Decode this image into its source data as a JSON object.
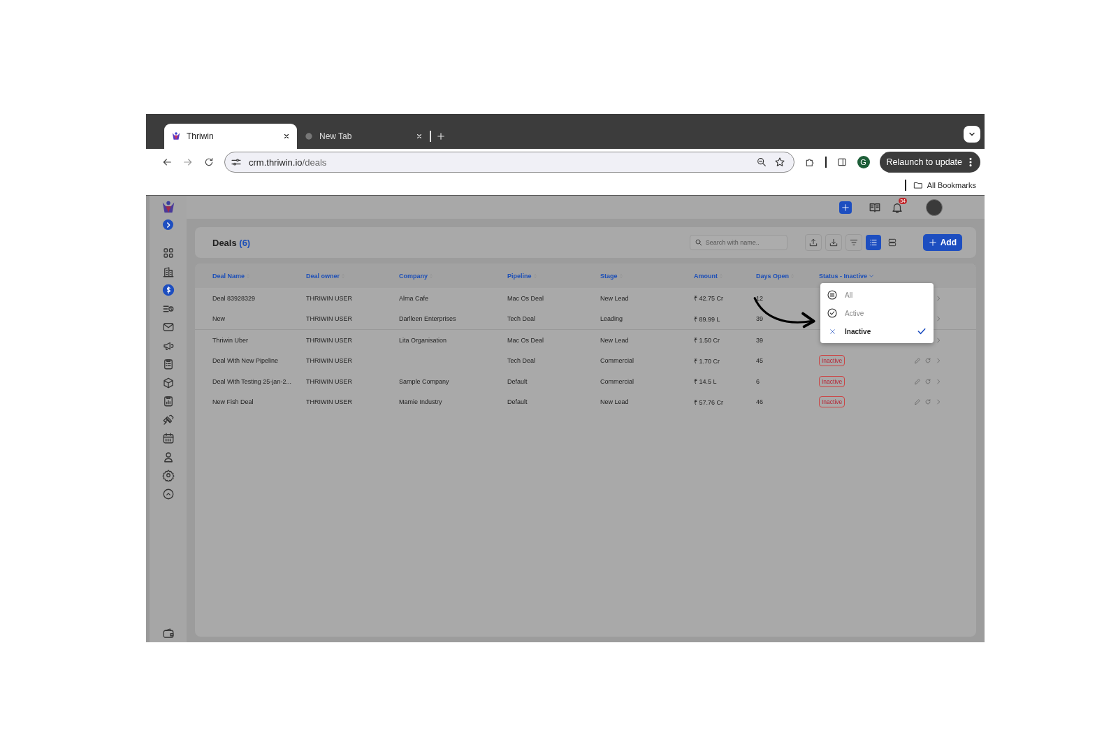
{
  "browser": {
    "tabs": [
      {
        "title": "Thriwin",
        "selected": true,
        "kind": "app"
      },
      {
        "title": "New Tab",
        "selected": false,
        "kind": "globe"
      }
    ],
    "url": {
      "host": "crm.thriwin.io",
      "path": "/deals"
    },
    "profile_initial": "G",
    "relaunch": "Relaunch to update",
    "bookmarks": "All Bookmarks"
  },
  "sidebar": {
    "items": [
      {
        "kind": "grid",
        "selected": false
      },
      {
        "kind": "building",
        "selected": false
      },
      {
        "kind": "dollar",
        "selected": true
      },
      {
        "kind": "list-clock",
        "selected": false
      },
      {
        "kind": "mail",
        "selected": false
      },
      {
        "kind": "megaphone",
        "selected": false
      },
      {
        "kind": "clipboard",
        "selected": false
      },
      {
        "kind": "box",
        "selected": false
      },
      {
        "kind": "report",
        "selected": false
      },
      {
        "kind": "satellite",
        "selected": false
      },
      {
        "kind": "calendar",
        "selected": false
      },
      {
        "kind": "person",
        "selected": false
      },
      {
        "kind": "gear",
        "selected": false
      },
      {
        "kind": "chevron-up",
        "selected": false
      }
    ]
  },
  "header": {
    "notification_count": "34"
  },
  "deals": {
    "title": "Deals",
    "count": "(6)",
    "search": {
      "placeholder": "Search with name.."
    },
    "views": [
      {
        "kind": "list",
        "selected": true
      },
      {
        "kind": "cards",
        "selected": false
      }
    ],
    "add_button": "Add"
  },
  "table": {
    "columns": [
      {
        "label": "Deal Name",
        "kind": "sort"
      },
      {
        "label": "Deal owner",
        "kind": "sort"
      },
      {
        "label": "Company",
        "kind": "sort"
      },
      {
        "label": "Pipeline",
        "kind": "sort"
      },
      {
        "label": "Stage",
        "kind": "sort"
      },
      {
        "label": "Amount",
        "kind": "sort"
      },
      {
        "label": "Days Open",
        "kind": "sort"
      },
      {
        "label": "Status - Inactive",
        "kind": "filter"
      }
    ],
    "rows": [
      {
        "cells": [
          "Deal 83928329",
          "THRIWIN USER",
          "Alma Cafe",
          "Mac Os Deal",
          "New Lead",
          "₹ 42.75 Cr",
          "12"
        ]
      },
      {
        "cells": [
          "New",
          "THRIWIN USER",
          "Darlleen Enterprises",
          "Tech Deal",
          "Leading",
          "₹ 89.99 L",
          "39"
        ]
      },
      {
        "cells": [
          "Thriwin Uber",
          "THRIWIN USER",
          "Lita Organisation",
          "Mac Os Deal",
          "New Lead",
          "₹ 1.50 Cr",
          "39"
        ]
      },
      {
        "cells": [
          "Deal With New Pipeline",
          "THRIWIN USER",
          "",
          "Tech Deal",
          "Commercial",
          "₹ 1.70 Cr",
          "45"
        ],
        "status": "Inactive"
      },
      {
        "cells": [
          "Deal With Testing 25-jan-2...",
          "THRIWIN USER",
          "Sample Company",
          "Default",
          "Commercial",
          "₹ 14.5 L",
          "6"
        ],
        "status": "Inactive"
      },
      {
        "cells": [
          "New Fish Deal",
          "THRIWIN USER",
          "Mamie Industry",
          "Default",
          "New Lead",
          "₹ 57.76 Cr",
          "46"
        ],
        "status": "Inactive"
      }
    ]
  },
  "status_menu": {
    "options": [
      {
        "label": "All",
        "kind": "list",
        "selected": false
      },
      {
        "label": "Active",
        "kind": "check-circle",
        "selected": false
      },
      {
        "label": "Inactive",
        "kind": "cross",
        "selected": true
      }
    ]
  }
}
